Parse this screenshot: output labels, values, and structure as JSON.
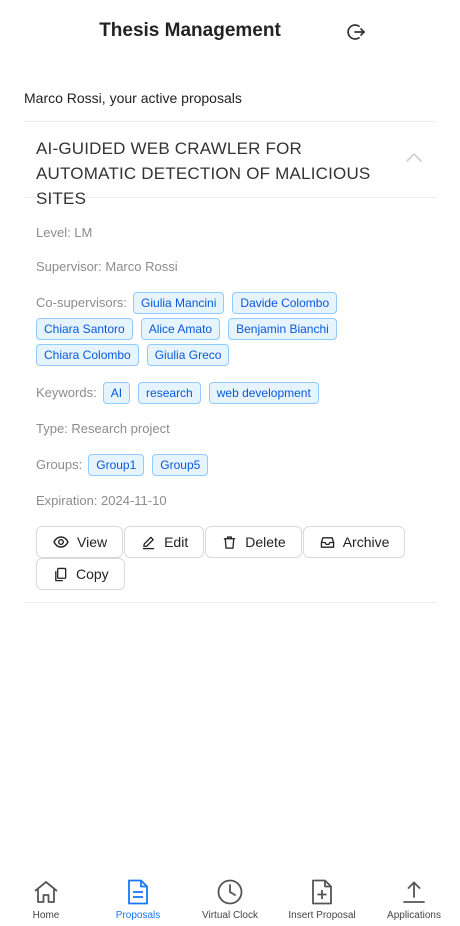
{
  "header": {
    "title": "Thesis Management"
  },
  "subtitle": "Marco Rossi, your active proposals",
  "proposal": {
    "title": "AI-GUIDED WEB CRAWLER FOR AUTOMATIC DETECTION OF MALICIOUS SITES",
    "level": "Level: LM",
    "supervisor": "Supervisor: Marco Rossi",
    "cosupervisors_label": "Co-supervisors:",
    "cosupervisors": [
      "Giulia Mancini",
      "Davide Colombo",
      "Chiara Santoro",
      "Alice Amato",
      "Benjamin Bianchi",
      "Chiara Colombo",
      "Giulia Greco"
    ],
    "keywords_label": "Keywords:",
    "keywords": [
      "AI",
      "research",
      "web development"
    ],
    "type": "Type: Research project",
    "groups_label": "Groups:",
    "groups": [
      "Group1",
      "Group5"
    ],
    "expiration": "Expiration: 2024-11-10"
  },
  "actions": {
    "view": "View",
    "edit": "Edit",
    "delete": "Delete",
    "archive": "Archive",
    "copy": "Copy"
  },
  "nav": {
    "home": "Home",
    "proposals": "Proposals",
    "virtual_clock": "Virtual Clock",
    "insert_proposal": "Insert Proposal",
    "applications": "Applications"
  },
  "colors": {
    "accent": "#1677ff",
    "tag_text": "#0958d9",
    "tag_bg": "#e6f4ff",
    "tag_border": "#91caff"
  }
}
